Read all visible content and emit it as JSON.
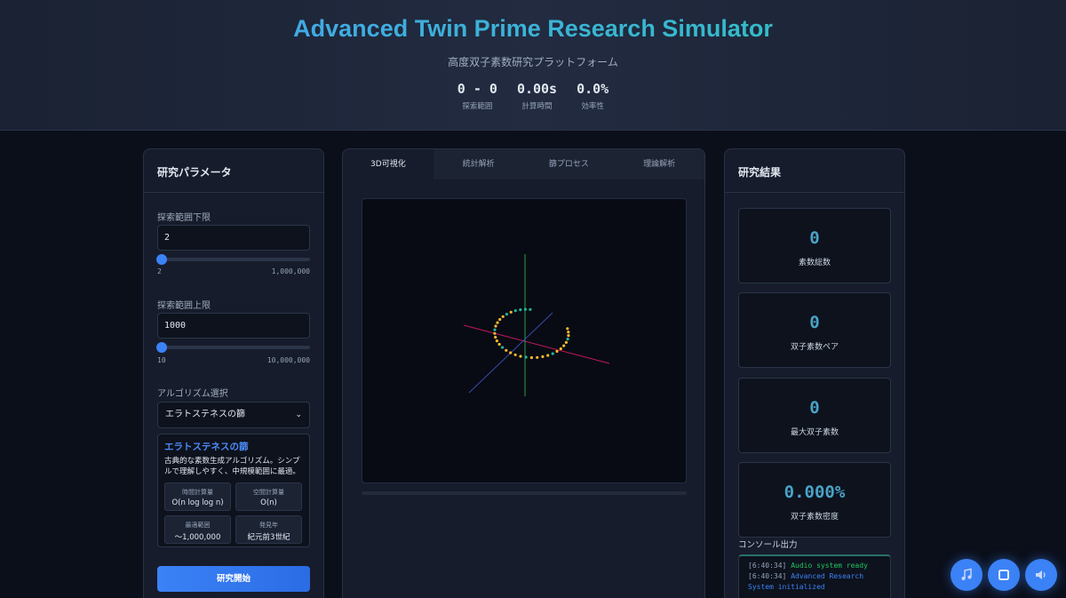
{
  "header": {
    "title": "Advanced Twin Prime Research Simulator",
    "subtitle": "高度双子素数研究プラットフォーム",
    "stats": [
      {
        "value": "0 - 0",
        "label": "探索範囲"
      },
      {
        "value": "0.00s",
        "label": "計算時間"
      },
      {
        "value": "0.0%",
        "label": "効率性"
      }
    ]
  },
  "params": {
    "title": "研究パラメータ",
    "lower": {
      "label": "探索範囲下限",
      "value": "2",
      "min": "2",
      "max": "1,000,000",
      "slider_fraction": 0
    },
    "upper": {
      "label": "探索範囲上限",
      "value": "1000",
      "min": "10",
      "max": "10,000,000",
      "slider_fraction": 0
    },
    "algorithm": {
      "label": "アルゴリズム選択",
      "selected": "エラトステネスの篩",
      "card": {
        "name": "エラトステネスの篩",
        "description": "古典的な素数生成アルゴリズム。シンプルで理解しやすく、中規模範囲に最適。",
        "metrics": [
          {
            "label": "時間計算量",
            "value": "O(n log log n)"
          },
          {
            "label": "空間計算量",
            "value": "O(n)"
          },
          {
            "label": "最適範囲",
            "value": "〜1,000,000"
          },
          {
            "label": "発見年",
            "value": "紀元前3世紀"
          }
        ]
      }
    },
    "start_button": "研究開始"
  },
  "tabs": [
    {
      "label": "3D可視化",
      "active": true
    },
    {
      "label": "統計解析",
      "active": false
    },
    {
      "label": "篩プロセス",
      "active": false
    },
    {
      "label": "理論解析",
      "active": false
    }
  ],
  "colors": {
    "accent": "#3b82f6",
    "x_axis": "#c2185b",
    "y_axis": "#2e9e44",
    "z_axis": "#3949ab",
    "prime_dot": "#f5b731",
    "twin_dot": "#1fb59a"
  },
  "results": {
    "title": "研究結果",
    "cards": [
      {
        "value": "0",
        "label": "素数総数"
      },
      {
        "value": "0",
        "label": "双子素数ペア"
      },
      {
        "value": "0",
        "label": "最大双子素数"
      },
      {
        "value": "0.000%",
        "label": "双子素数密度"
      }
    ],
    "console_label": "コンソール出力",
    "console": [
      {
        "time": "[6:40:34]",
        "message": "Audio system ready",
        "type": "ok"
      },
      {
        "time": "[6:40:34]",
        "message": "Advanced Research System initialized",
        "type": "info"
      }
    ]
  },
  "fabs": [
    "music-icon",
    "stop-icon",
    "speaker-icon"
  ]
}
